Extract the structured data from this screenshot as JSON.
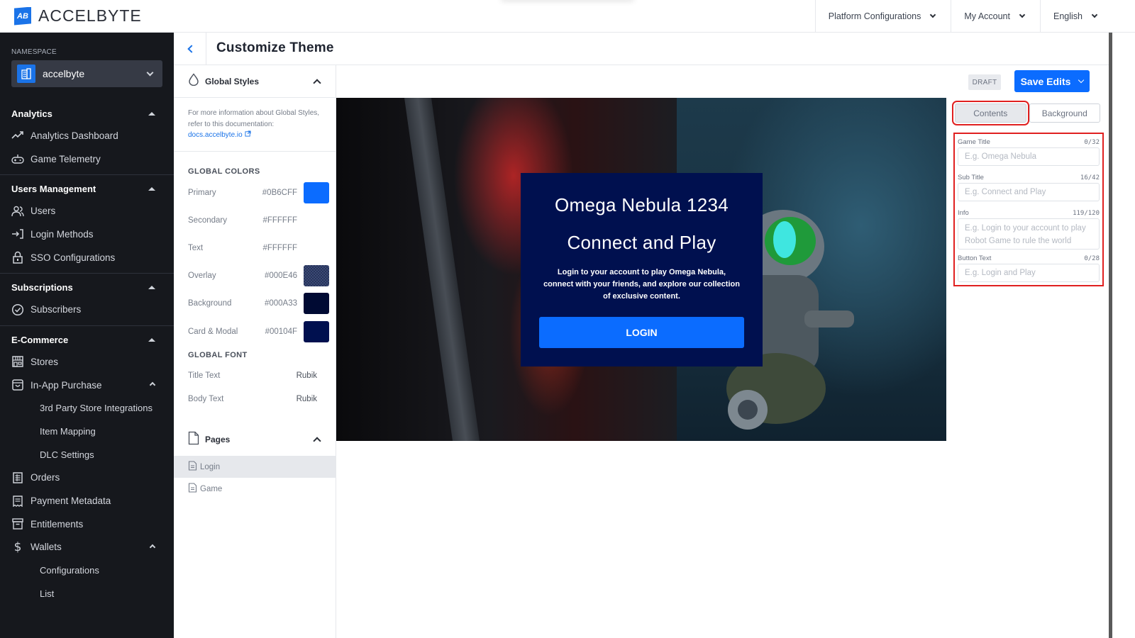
{
  "brand": {
    "name": "ACCELBYTE",
    "logo_glyph": "AB"
  },
  "topbar": {
    "menus": [
      {
        "label": "Platform Configurations",
        "icon": "chevron-down-icon"
      },
      {
        "label": "My Account",
        "icon": "chevron-down-icon"
      },
      {
        "label": "English",
        "icon": "chevron-down-icon"
      }
    ]
  },
  "sidebar": {
    "namespace_label": "NAMESPACE",
    "namespace_value": "accelbyte",
    "sections": [
      {
        "title": "Analytics",
        "items": [
          {
            "label": "Analytics Dashboard",
            "icon": "trending-up-icon"
          },
          {
            "label": "Game Telemetry",
            "icon": "gamepad-icon"
          }
        ]
      },
      {
        "title": "Users Management",
        "items": [
          {
            "label": "Users",
            "icon": "users-icon"
          },
          {
            "label": "Login Methods",
            "icon": "login-icon"
          },
          {
            "label": "SSO Configurations",
            "icon": "lock-icon"
          }
        ]
      },
      {
        "title": "Subscriptions",
        "items": [
          {
            "label": "Subscribers",
            "icon": "badge-check-icon"
          }
        ]
      },
      {
        "title": "E-Commerce",
        "items": [
          {
            "label": "Stores",
            "icon": "store-icon"
          },
          {
            "label": "In-App Purchase",
            "icon": "shopping-bag-icon",
            "expanded": true
          },
          {
            "label": "3rd Party Store Integrations",
            "sub": true
          },
          {
            "label": "Item Mapping",
            "sub": true
          },
          {
            "label": "DLC Settings",
            "sub": true
          },
          {
            "label": "Orders",
            "icon": "receipt-icon"
          },
          {
            "label": "Payment Metadata",
            "icon": "invoice-icon"
          },
          {
            "label": "Entitlements",
            "icon": "archive-icon"
          },
          {
            "label": "Wallets",
            "icon": "dollar-icon",
            "expanded": true
          },
          {
            "label": "Configurations",
            "sub": true
          },
          {
            "label": "List",
            "sub": true
          }
        ]
      }
    ]
  },
  "page": {
    "title": "Customize Theme",
    "back_icon": "chevron-left-icon"
  },
  "global_styles": {
    "title": "Global Styles",
    "info": "For more information about Global Styles, refer to this documentation:",
    "link": "docs.accelbyte.io",
    "colors_label": "GLOBAL COLORS",
    "colors": [
      {
        "label": "Primary",
        "hex": "#0B6CFF",
        "swatch": "#0B6CFF"
      },
      {
        "label": "Secondary",
        "hex": "#FFFFFF",
        "swatch": null
      },
      {
        "label": "Text",
        "hex": "#FFFFFF",
        "swatch": null
      },
      {
        "label": "Overlay",
        "hex": "#000E46",
        "swatch": "pattern"
      },
      {
        "label": "Background",
        "hex": "#000A33",
        "swatch": "#000A33"
      },
      {
        "label": "Card & Modal",
        "hex": "#00104F",
        "swatch": "#00104F"
      }
    ],
    "font_label": "GLOBAL FONT",
    "fonts": [
      {
        "label": "Title Text",
        "value": "Rubik"
      },
      {
        "label": "Body Text",
        "value": "Rubik"
      }
    ]
  },
  "pages": {
    "title": "Pages",
    "items": [
      {
        "label": "Login",
        "active": true
      },
      {
        "label": "Game",
        "active": false
      }
    ]
  },
  "toolbar": {
    "status": "DRAFT",
    "save_label": "Save Edits"
  },
  "preview": {
    "title": "Omega Nebula 1234",
    "subtitle": "Connect and Play",
    "info": "Login to your account to play Omega Nebula, connect with your friends, and explore our collection of exclusive content.",
    "button": "LOGIN"
  },
  "editor": {
    "tabs": [
      {
        "label": "Contents",
        "active": true
      },
      {
        "label": "Background",
        "active": false
      }
    ],
    "fields": [
      {
        "label": "Game Title",
        "count": "0/32",
        "placeholder": "E.g. Omega Nebula"
      },
      {
        "label": "Sub Title",
        "count": "16/42",
        "placeholder": "E.g. Connect and Play"
      },
      {
        "label": "Info",
        "count": "119/120",
        "placeholder": "E.g. Login to your account to play Robot Game to rule the world"
      },
      {
        "label": "Button Text",
        "count": "0/28",
        "placeholder": "E.g. Login and Play"
      }
    ]
  }
}
